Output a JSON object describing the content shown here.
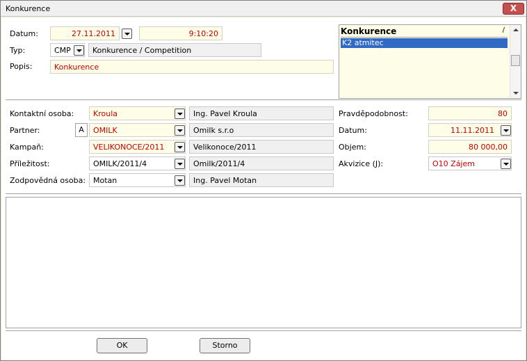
{
  "window": {
    "title": "Konkurence",
    "close_label": "X"
  },
  "header": {
    "datum_label": "Datum:",
    "datum_value": "27.11.2011",
    "time_value": "9:10:20",
    "typ_label": "Typ:",
    "typ_code": "CMP",
    "typ_name": "Konkurence / Competition",
    "popis_label": "Popis:",
    "popis_value": "Konkurence"
  },
  "listbox": {
    "header": "Konkurence",
    "sort_mark": "/",
    "selected_item": "K2 atmitec"
  },
  "details": {
    "kontakt_label": "Kontaktní osoba:",
    "kontakt_code": "Kroula",
    "kontakt_name": "Ing. Pavel Kroula",
    "partner_label": "Partner:",
    "partner_flag": "A",
    "partner_code": "OMILK",
    "partner_name": "Omilk s.r.o",
    "kampan_label": "Kampaň:",
    "kampan_code": "VELIKONOCE/2011",
    "kampan_name": "Velikonoce/2011",
    "prilezitost_label": "Příležitost:",
    "prilezitost_code": "OMILK/2011/4",
    "prilezitost_name": "Omilk/2011/4",
    "zodpovedna_label": "Zodpovědná osoba:",
    "zodpovedna_code": "Motan",
    "zodpovedna_name": "Ing. Pavel Motan"
  },
  "right": {
    "pravdepodobnost_label": "Pravděpodobnost:",
    "pravdepodobnost_value": "80",
    "datum_label": "Datum:",
    "datum_value": "11.11.2011",
    "objem_label": "Objem:",
    "objem_value": "80 000,00",
    "akvizice_label": "Akvizice (J):",
    "akvizice_value": "O10 Zájem"
  },
  "footer": {
    "ok_label": "OK",
    "storno_label": "Storno"
  },
  "colors": {
    "required_bg": "#fefee8",
    "red_text": "#c00000",
    "selection": "#316ac5"
  }
}
